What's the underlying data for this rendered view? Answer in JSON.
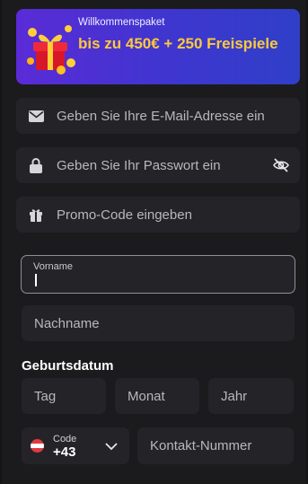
{
  "promo": {
    "subtitle": "Willkommenspaket",
    "headline": "bis zu 450€ + 250 Freispiele"
  },
  "fields": {
    "email_placeholder": "Geben Sie Ihre E-Mail-Adresse ein",
    "password_placeholder": "Geben Sie Ihr Passwort ein",
    "promo_placeholder": "Promo-Code eingeben",
    "first_name_label": "Vorname",
    "last_name_placeholder": "Nachname"
  },
  "birthdate": {
    "label": "Geburtsdatum",
    "day": "Tag",
    "month": "Monat",
    "year": "Jahr"
  },
  "phone": {
    "code_label": "Code",
    "code_value": "+43",
    "number_placeholder": "Kontakt-Nummer"
  },
  "colors": {
    "accent_yellow": "#ffc93b",
    "banner_start": "#5a2bd6",
    "banner_end": "#2f3fc8",
    "field_bg": "#242428"
  },
  "icons": [
    "gift-box-icon",
    "envelope-icon",
    "lock-icon",
    "eye-off-icon",
    "gift-icon",
    "austria-flag-icon",
    "chevron-down-icon"
  ]
}
